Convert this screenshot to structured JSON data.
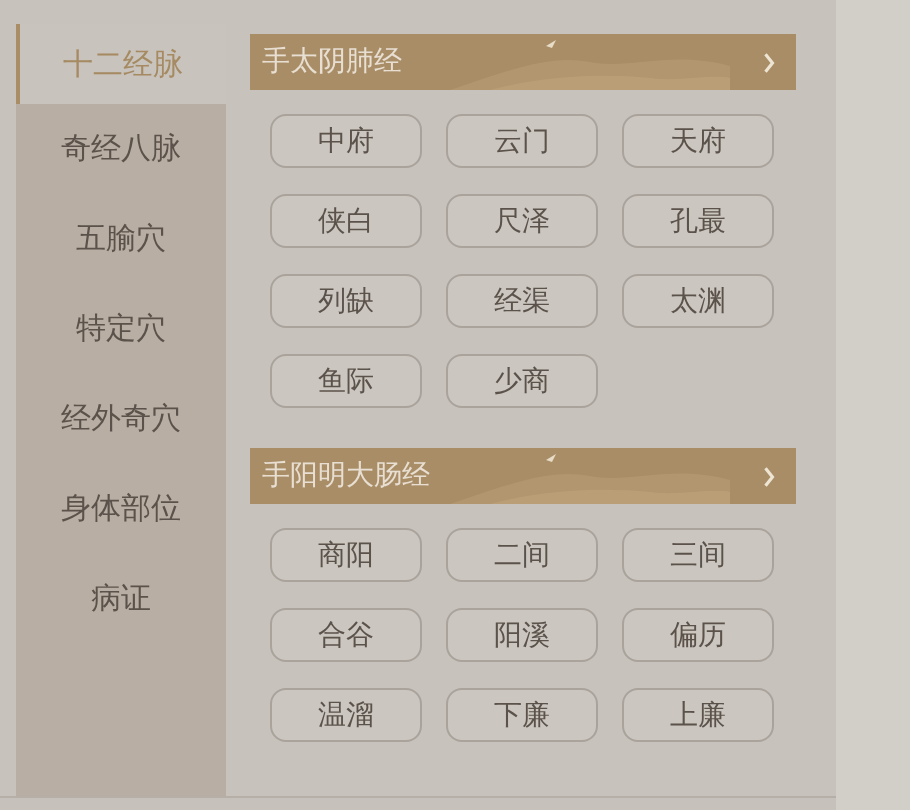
{
  "sidebar": {
    "items": [
      {
        "label": "十二经脉",
        "selected": true
      },
      {
        "label": "奇经八脉",
        "selected": false
      },
      {
        "label": "五腧穴",
        "selected": false
      },
      {
        "label": "特定穴",
        "selected": false
      },
      {
        "label": "经外奇穴",
        "selected": false
      },
      {
        "label": "身体部位",
        "selected": false
      },
      {
        "label": "病证",
        "selected": false
      }
    ]
  },
  "sections": [
    {
      "title": "手太阴肺经",
      "points": [
        "中府",
        "云门",
        "天府",
        "侠白",
        "尺泽",
        "孔最",
        "列缺",
        "经渠",
        "太渊",
        "鱼际",
        "少商"
      ]
    },
    {
      "title": "手阳明大肠经",
      "points": [
        "商阳",
        "二间",
        "三间",
        "合谷",
        "阳溪",
        "偏历",
        "温溜",
        "下廉",
        "上廉"
      ]
    }
  ]
}
